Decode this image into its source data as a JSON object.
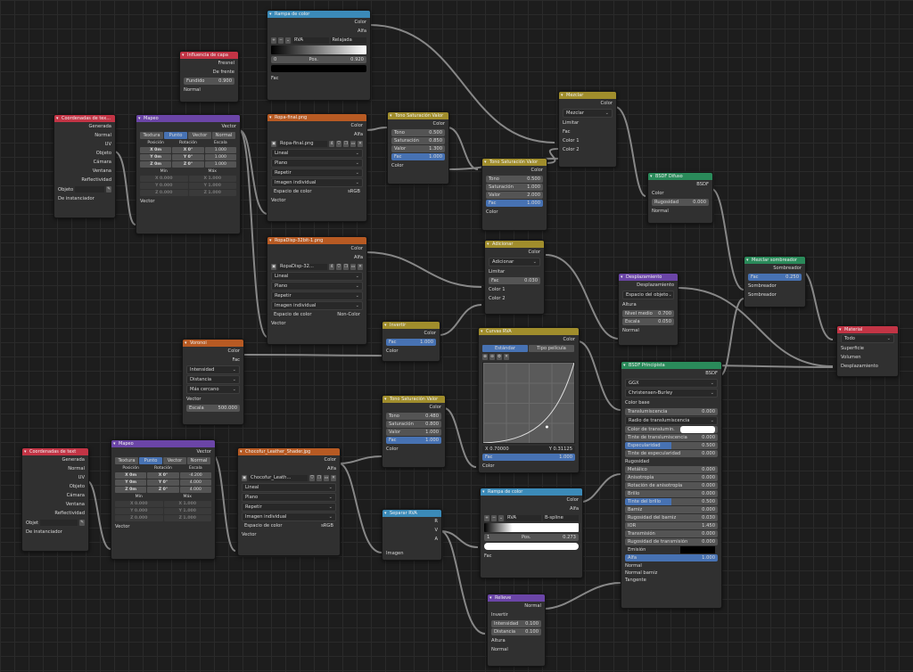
{
  "nodes": {
    "rampa_color_top": {
      "title": "Rampa de color",
      "color_out": "Color",
      "alpha_out": "Alfa",
      "mode": "RVA",
      "interp": "Relajada",
      "pos_index": "0",
      "pos_label": "Pos.",
      "pos_value": "0.920",
      "fac": "Fac"
    },
    "influencia": {
      "title": "Influencia de capa",
      "fresnel": "Fresnel",
      "facing": "De frente",
      "blend_label": "Fundido",
      "blend_value": "0.900",
      "normal": "Normal"
    },
    "coords1": {
      "title": "Coordenadas de tex...",
      "outs": [
        "Generada",
        "Normal",
        "UV",
        "Objeto",
        "Cámara",
        "Ventana",
        "Reflectividad"
      ],
      "object_label": "Objeto",
      "instancer": "De instanciador"
    },
    "mapeo1": {
      "title": "Mapeo",
      "vector_out": "Vector",
      "tabs": [
        "Textura",
        "Punto",
        "Vector",
        "Normal"
      ],
      "head": [
        "Posición",
        "Rotación",
        "Escala"
      ],
      "x": [
        "X",
        "0m",
        "X",
        "0°",
        "1.000"
      ],
      "y": [
        "Y",
        "0m",
        "Y",
        "0°",
        "1.000"
      ],
      "z": [
        "Z",
        "0m",
        "Z",
        "0°",
        "1.000"
      ],
      "min": "Mín",
      "max": "Máx",
      "minx": [
        "X",
        "0.000",
        "X",
        "1.000"
      ],
      "miny": [
        "Y",
        "0.000",
        "Y",
        "1.000"
      ],
      "minz": [
        "Z",
        "0.000",
        "Z",
        "1.000"
      ],
      "vector_in": "Vector"
    },
    "ropa_final": {
      "title": "Ropa-final.png",
      "color_out": "Color",
      "alpha_out": "Alfa",
      "file": "Ropa-final.png",
      "users": "4",
      "opts": [
        "Lineal",
        "Plano",
        "Repetir",
        "Imagen individual"
      ],
      "cs_label": "Espacio de color",
      "cs_value": "sRGB",
      "vector_in": "Vector"
    },
    "ropa_disp": {
      "title": "RopaDisp-32bit-1.png",
      "color_out": "Color",
      "alpha_out": "Alfa",
      "file": "RopaDisp-32...",
      "users": "4",
      "opts": [
        "Lineal",
        "Plano",
        "Repetir",
        "Imagen individual"
      ],
      "cs_label": "Espacio de color",
      "cs_value": "Non-Color",
      "vector_in": "Vector"
    },
    "tsv1": {
      "title": "Tono Saturación Valor",
      "color_out": "Color",
      "tono": [
        "Tono",
        "0.500"
      ],
      "sat": [
        "Saturación",
        "0.850"
      ],
      "val": [
        "Valor",
        "1.300"
      ],
      "fac": [
        "Fac",
        "1.000"
      ],
      "color_in": "Color"
    },
    "tsv2": {
      "title": "Tono Saturación Valor",
      "color_out": "Color",
      "tono": [
        "Tono",
        "0.500"
      ],
      "sat": [
        "Saturación",
        "1.000"
      ],
      "val": [
        "Valor",
        "2.000"
      ],
      "fac": [
        "Fac",
        "1.000"
      ],
      "color_in": "Color"
    },
    "mezclar": {
      "title": "Mezclar",
      "color_out": "Color",
      "mode": "Mezclar",
      "clamp": "Limitar",
      "fac": "Fac",
      "c1": "Color 1",
      "c2": "Color 2"
    },
    "bsdf_difuso": {
      "title": "BSDF Difuso",
      "bsdf_out": "BSDF",
      "color": "Color",
      "rough": [
        "Rugosidad",
        "0.000"
      ],
      "normal": "Normal"
    },
    "adicionar": {
      "title": "Adicionar",
      "color_out": "Color",
      "mode": "Adicionar",
      "clamp": "Limitar",
      "fac": [
        "Fac",
        "0.030"
      ],
      "c1": "Color 1",
      "c2": "Color 2"
    },
    "desplazamiento": {
      "title": "Desplazamiento",
      "out": "Desplazamiento",
      "space": "Espacio del objeto",
      "height": "Altura",
      "mid": [
        "Nivel medio",
        "0.700"
      ],
      "scale": [
        "Escala",
        "0.050"
      ],
      "normal": "Normal"
    },
    "mezclar_shader": {
      "title": "Mezclar sombreador",
      "out": "Sombreador",
      "fac": [
        "Fac",
        "0.250"
      ],
      "s1": "Sombreador",
      "s2": "Sombreador"
    },
    "material": {
      "title": "Material",
      "target": "Todo",
      "surface": "Superficie",
      "volume": "Volumen",
      "disp": "Desplazamiento"
    },
    "invertir": {
      "title": "Invertir",
      "color_out": "Color",
      "fac": [
        "Fac",
        "1.000"
      ],
      "color_in": "Color"
    },
    "voronoi": {
      "title": "Voronoi",
      "color_out": "Color",
      "fac_out": "Fac",
      "dim": "Intensidad",
      "dist": "Distancia",
      "feat": "Más cercano",
      "vector_in": "Vector",
      "scale": [
        "Escala",
        "500.000"
      ]
    },
    "curvas": {
      "title": "Curvas RVA",
      "color_out": "Color",
      "tabs": [
        "Estándar",
        "Tipo película"
      ],
      "x": "X 0.70000",
      "y": "Y 0.31125",
      "fac": [
        "Fac",
        "1.000"
      ],
      "color_in": "Color"
    },
    "bsdf_principled": {
      "title": "BSDF Principista",
      "bsdf_out": "BSDF",
      "dist": "GGX",
      "sss": "Christensen-Burley",
      "rows": [
        [
          "Color base",
          ""
        ],
        [
          "Translumiscencia",
          "0.000"
        ],
        [
          "Radio de translumiscencia",
          ""
        ],
        [
          "Color de translumin.",
          ""
        ],
        [
          "Tinte de translumiscencia",
          "0.000"
        ],
        [
          "Especularidad",
          "0.500"
        ],
        [
          "Tinte de especularidad",
          "0.000"
        ],
        [
          "Rugosidad",
          ""
        ],
        [
          "Metálico",
          "0.000"
        ],
        [
          "Anisotropía",
          "0.000"
        ],
        [
          "Rotación de anisotropía",
          "0.000"
        ],
        [
          "Brillo",
          "0.000"
        ],
        [
          "Tinte del brillo",
          "0.500"
        ],
        [
          "Barniz",
          "0.000"
        ],
        [
          "Rugosidad del barniz",
          "0.030"
        ],
        [
          "IOR",
          "1.450"
        ],
        [
          "Transmisión",
          "0.000"
        ],
        [
          "Rugosidad de transmisión",
          "0.000"
        ],
        [
          "Emisión",
          ""
        ],
        [
          "Alfa",
          "1.000"
        ],
        [
          "Normal",
          ""
        ],
        [
          "Normal barniz",
          ""
        ],
        [
          "Tangente",
          ""
        ]
      ]
    },
    "coords2": {
      "title": "Coordenadas de text",
      "outs": [
        "Generada",
        "Normal",
        "UV",
        "Objeto",
        "Cámara",
        "Ventana",
        "Reflectividad"
      ],
      "object_label": "Objet",
      "instancer": "De instanciador"
    },
    "mapeo2": {
      "title": "Mapeo",
      "vector_out": "Vector",
      "tabs": [
        "Textura",
        "Punto",
        "Vector",
        "Normal"
      ],
      "head": [
        "Posición",
        "Rotación",
        "Escala"
      ],
      "x": [
        "X",
        "0m",
        "X",
        "0°",
        "-4.200"
      ],
      "y": [
        "Y",
        "0m",
        "Y",
        "0°",
        "4.000"
      ],
      "z": [
        "Z",
        "0m",
        "Z",
        "0°",
        "4.000"
      ],
      "min": "Mín",
      "max": "Máx",
      "minx": [
        "X",
        "0.000",
        "X",
        "1.000"
      ],
      "miny": [
        "Y",
        "0.000",
        "Y",
        "1.000"
      ],
      "minz": [
        "Z",
        "0.000",
        "Z",
        "1.000"
      ],
      "vector_in": "Vector"
    },
    "chocofur": {
      "title": "Chocofur_Leather_Shader.jpg",
      "color_out": "Color",
      "alpha_out": "Alfa",
      "file": "Chocofur_Leath...",
      "opts": [
        "Lineal",
        "Plano",
        "Repetir",
        "Imagen individual"
      ],
      "cs_label": "Espacio de color",
      "cs_value": "sRGB",
      "vector_in": "Vector"
    },
    "tsv3": {
      "title": "Tono Saturación Valor",
      "color_out": "Color",
      "tono": [
        "Tono",
        "0.480"
      ],
      "sat": [
        "Saturación",
        "0.800"
      ],
      "val": [
        "Valor",
        "1.000"
      ],
      "fac": [
        "Fac",
        "1.000"
      ],
      "color_in": "Color"
    },
    "separar": {
      "title": "Separar RVA",
      "r": "R",
      "v": "V",
      "a": "A",
      "img": "Imagen"
    },
    "rampa_color_bot": {
      "title": "Rampa de color",
      "color_out": "Color",
      "alpha_out": "Alfa",
      "mode": "RVA",
      "interp": "B-spline",
      "pos_index": "1",
      "pos_label": "Pos.",
      "pos_value": "0.273",
      "fac": "Fac"
    },
    "relieve": {
      "title": "Relieve",
      "normal_out": "Normal",
      "invert": "Invertir",
      "strength": [
        "Intensidad",
        "0.100"
      ],
      "distance": [
        "Distancia",
        "0.100"
      ],
      "height": "Altura",
      "normal_in": "Normal"
    }
  }
}
